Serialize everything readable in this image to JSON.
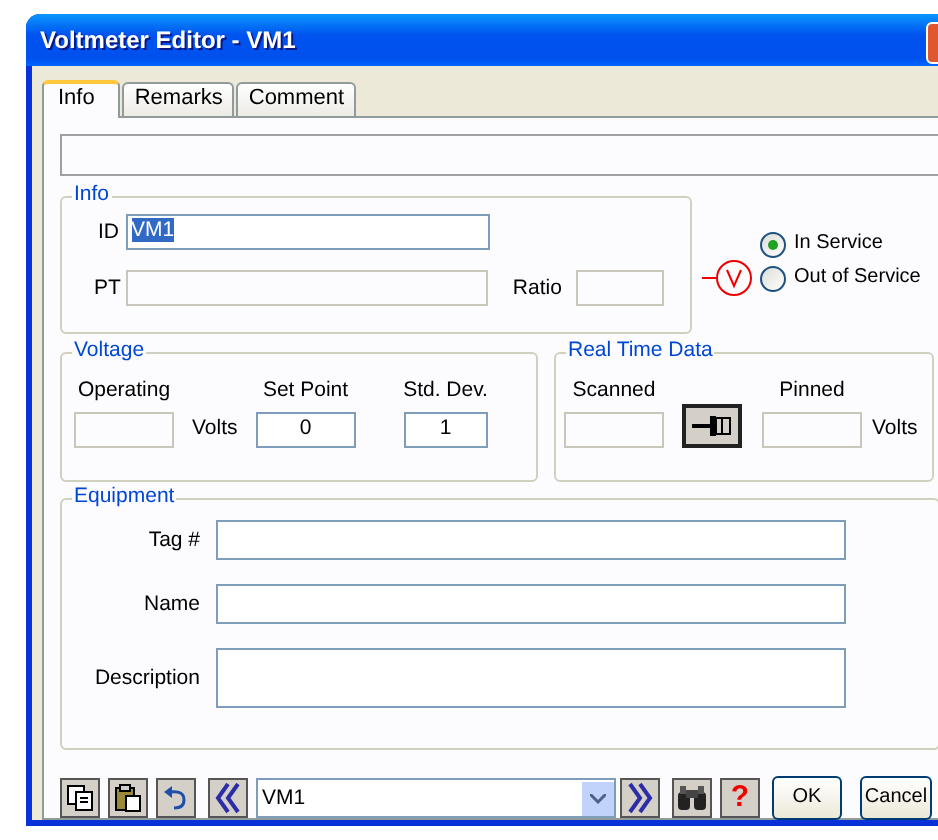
{
  "window": {
    "title": "Voltmeter Editor - VM1"
  },
  "tabs": [
    {
      "label": "Info",
      "selected": true
    },
    {
      "label": "Remarks",
      "selected": false
    },
    {
      "label": "Comment",
      "selected": false
    }
  ],
  "info": {
    "title": "Info",
    "id_label": "ID",
    "id_value": "VM1",
    "id_value_selected": true,
    "pt_label": "PT",
    "ratio_label": "Ratio"
  },
  "service": [
    {
      "label": "In Service",
      "selected": true
    },
    {
      "label": "Out of Service",
      "selected": false
    }
  ],
  "voltage": {
    "title": "Voltage",
    "operating_label": "Operating",
    "units": "Volts",
    "set_point_label": "Set Point",
    "set_point": "0",
    "std_dev_label": "Std. Dev.",
    "std_dev": "1"
  },
  "real_time": {
    "title": "Real Time Data",
    "scanned_label": "Scanned",
    "pinned_label": "Pinned",
    "units": "Volts"
  },
  "equipment": {
    "title": "Equipment",
    "fields": [
      {
        "label": "Tag #",
        "kind": "line"
      },
      {
        "label": "Name",
        "kind": "line"
      },
      {
        "label": "Description",
        "kind": "multiline"
      }
    ]
  },
  "footer": {
    "record": "VM1",
    "help": "?",
    "buttons": [
      "OK",
      "Cancel"
    ]
  }
}
